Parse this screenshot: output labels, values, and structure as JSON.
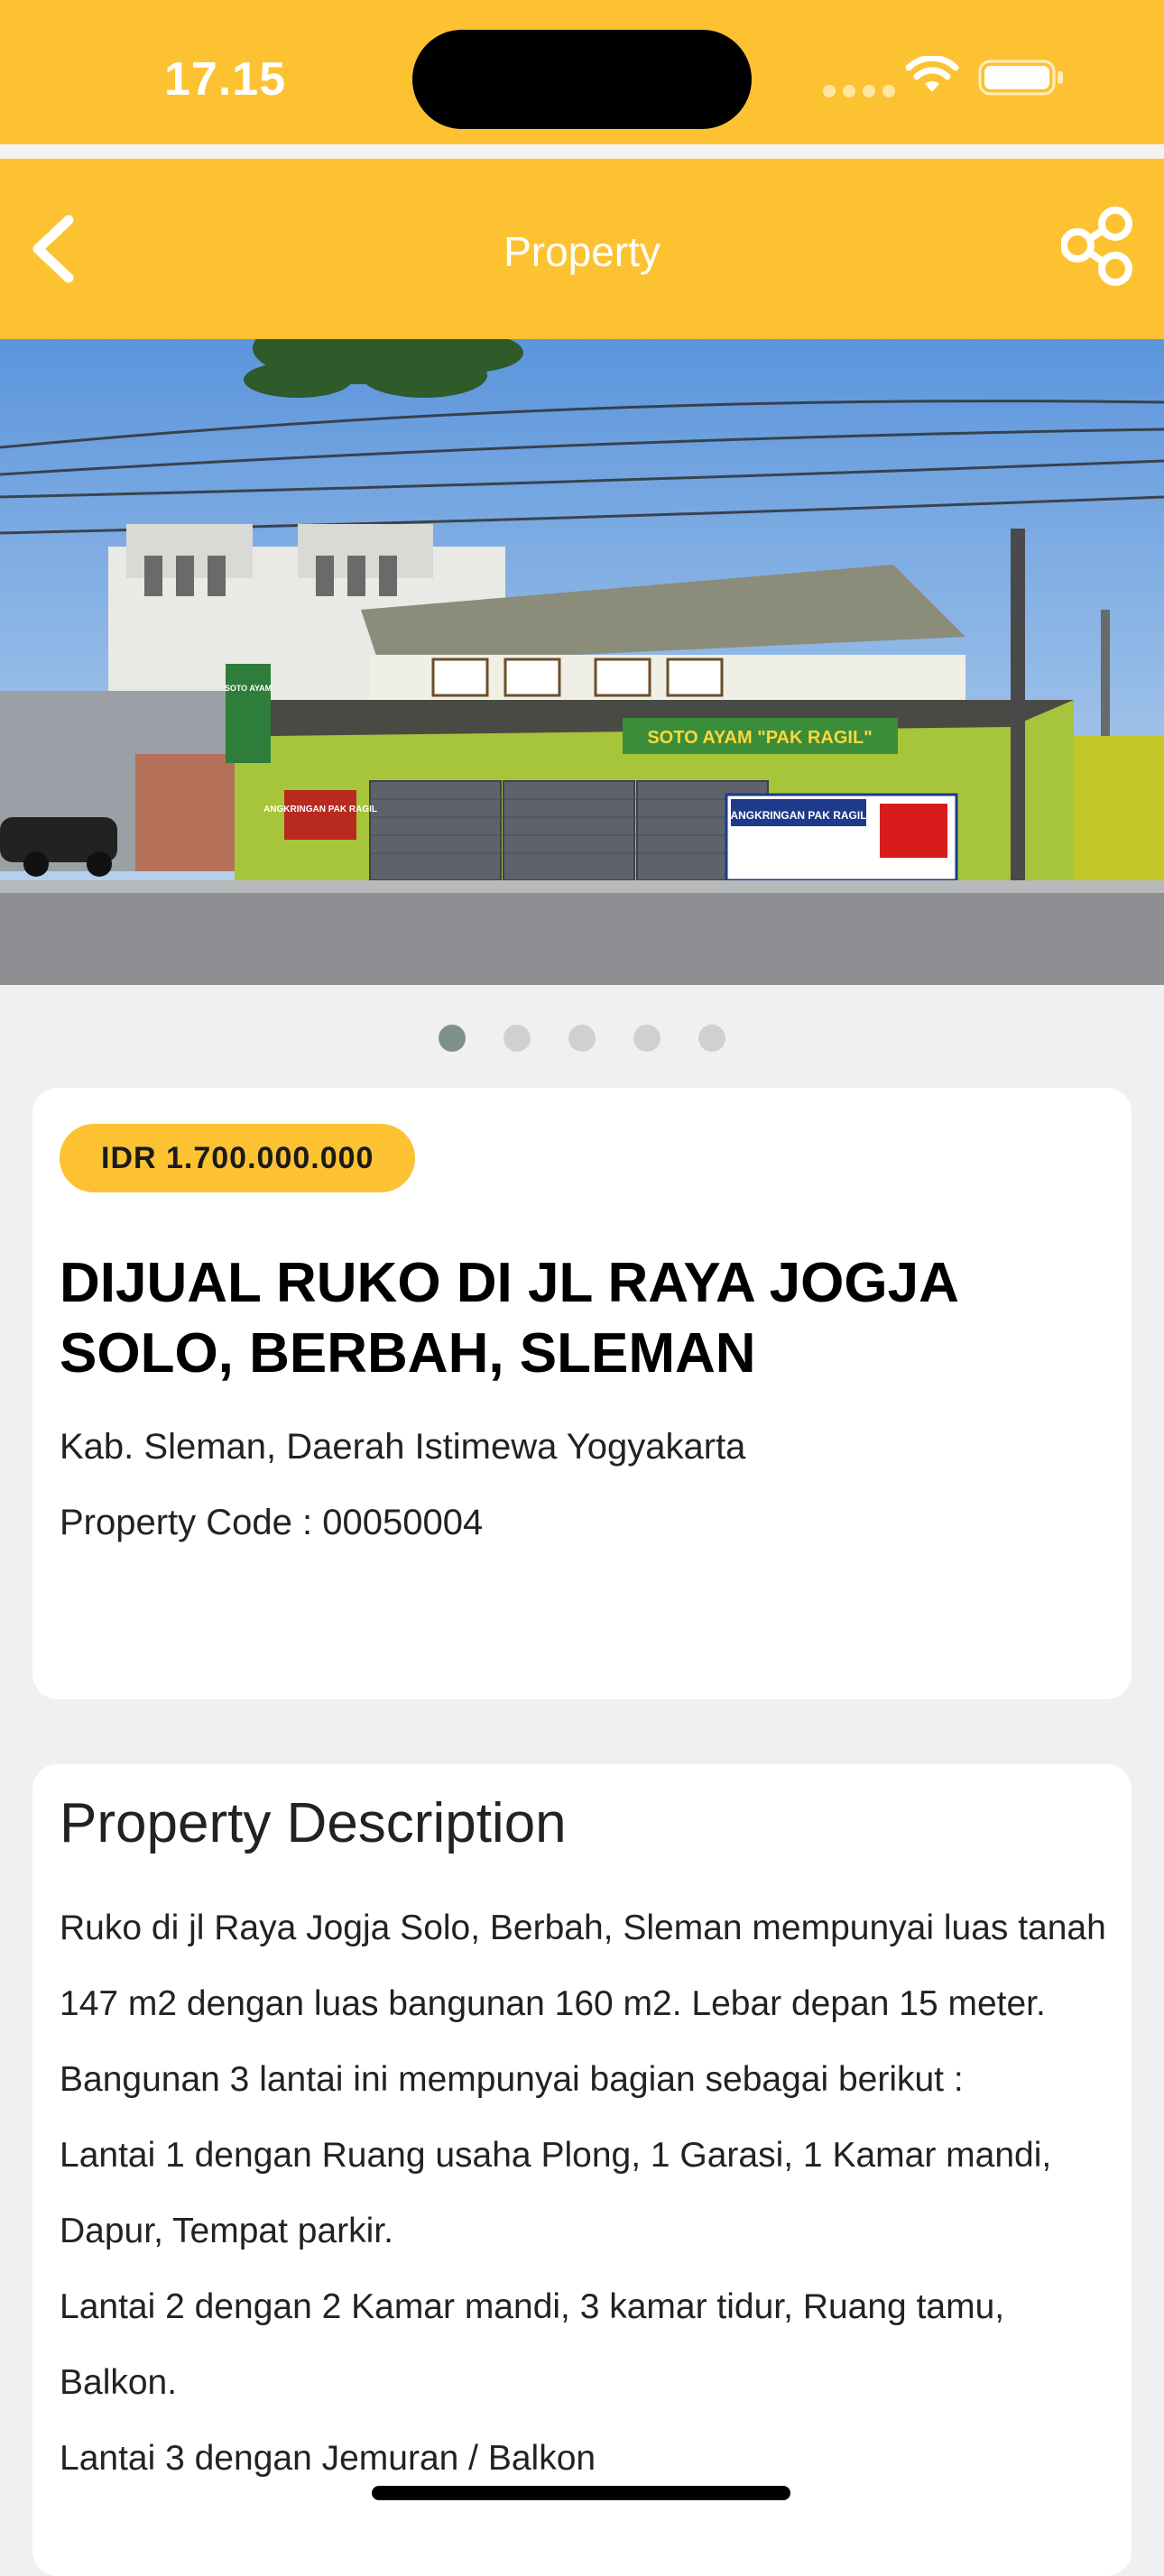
{
  "status_bar": {
    "time": "17.15"
  },
  "nav": {
    "title": "Property",
    "back_icon": "chevron-left-icon",
    "share_icon": "share-icon"
  },
  "gallery": {
    "total_images": 5,
    "active_index": 0,
    "photo_texts": {
      "sign_top": "SOTO AYAM \"PAK RAGIL\"",
      "banner_left": "ANGKRINGAN PAK RAGIL",
      "banner_right": "ANGKRINGAN PAK RAGIL",
      "small_sign": "SOTO AYAM"
    }
  },
  "listing": {
    "price": "IDR 1.700.000.000",
    "title": "DIJUAL RUKO DI JL RAYA JOGJA SOLO, BERBAH, SLEMAN",
    "location": "Kab. Sleman, Daerah Istimewa Yogyakarta",
    "code_label": "Property Code : 00050004"
  },
  "description": {
    "heading": "Property Description",
    "paragraphs": [
      "Ruko di jl Raya Jogja Solo, Berbah, Sleman mempunyai luas tanah 147 m2 dengan luas bangunan 160 m2. Lebar depan 15 meter. Bangunan 3 lantai ini mempunyai bagian sebagai berikut :",
      "Lantai 1 dengan Ruang usaha Plong, 1 Garasi, 1 Kamar mandi, Dapur, Tempat parkir.",
      "Lantai 2 dengan 2 Kamar mandi, 3 kamar tidur, Ruang tamu, Balkon.",
      "Lantai 3 dengan Jemuran / Balkon"
    ]
  },
  "colors": {
    "brand_yellow": "#fdc232",
    "background": "#f0f0f0",
    "card": "#ffffff",
    "active_dot": "#7d9189"
  }
}
